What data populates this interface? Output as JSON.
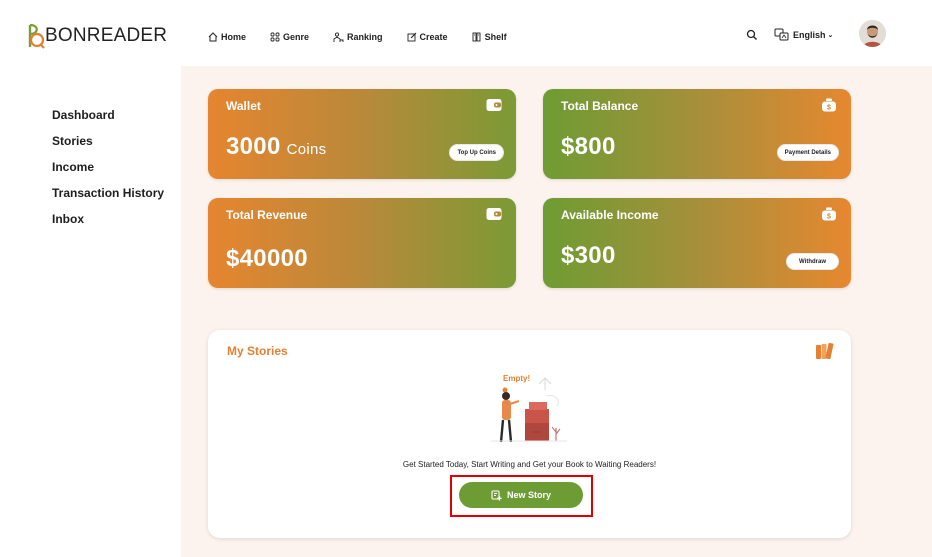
{
  "app": {
    "logo_text": "BONREADER"
  },
  "nav": [
    {
      "label": "Home",
      "icon": "home-icon"
    },
    {
      "label": "Genre",
      "icon": "grid-icon"
    },
    {
      "label": "Ranking",
      "icon": "ranking-icon"
    },
    {
      "label": "Create",
      "icon": "edit-icon"
    },
    {
      "label": "Shelf",
      "icon": "bookshelf-icon"
    }
  ],
  "header": {
    "language": "English"
  },
  "sidebar": {
    "items": [
      {
        "label": "Dashboard"
      },
      {
        "label": "Stories"
      },
      {
        "label": "Income"
      },
      {
        "label": "Transaction History"
      },
      {
        "label": "Inbox"
      }
    ]
  },
  "cards": {
    "wallet": {
      "title": "Wallet",
      "value": "3000",
      "unit": "Coins",
      "button": "Top Up Coins",
      "icon": "wallet-icon"
    },
    "total_balance": {
      "title": "Total Balance",
      "value": "$800",
      "button": "Payment Details",
      "icon": "money-bag-icon"
    },
    "total_revenue": {
      "title": "Total Revenue",
      "value": "$40000",
      "icon": "wallet-icon"
    },
    "available_income": {
      "title": "Available Income",
      "value": "$300",
      "button": "Withdraw",
      "icon": "money-bag-icon"
    }
  },
  "stories": {
    "title": "My Stories",
    "empty_label": "Empty!",
    "message": "Get Started Today, Start Writing and Get your Book to Waiting Readers!",
    "button": "New Story"
  },
  "colors": {
    "accent_orange": "#e58132",
    "accent_green": "#6d9c35",
    "highlight": "#e00000"
  }
}
